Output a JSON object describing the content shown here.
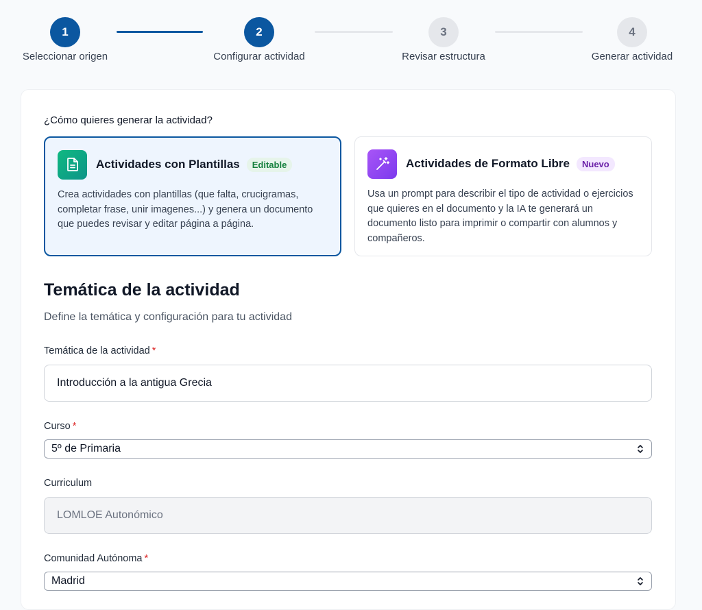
{
  "stepper": {
    "steps": [
      {
        "number": "1",
        "label": "Seleccionar origen"
      },
      {
        "number": "2",
        "label": "Configurar actividad"
      },
      {
        "number": "3",
        "label": "Revisar estructura"
      },
      {
        "number": "4",
        "label": "Generar actividad"
      }
    ],
    "current_step": 2
  },
  "generation": {
    "question": "¿Cómo quieres generar la actividad?",
    "options": [
      {
        "title": "Actividades con Plantillas",
        "badge": "Editable",
        "icon": "document-icon",
        "description": "Crea actividades con plantillas (que falta, crucigramas, completar frase, unir imagenes...) y genera un documento que puedes revisar y editar página a página.",
        "selected": true
      },
      {
        "title": "Actividades de Formato Libre",
        "badge": "Nuevo",
        "icon": "magic-wand-icon",
        "description": "Usa un prompt para describir el tipo de actividad o ejercicios que quieres en el documento y la IA te generará un documento listo para imprimir o compartir con alumnos y compañeros.",
        "selected": false
      }
    ]
  },
  "section": {
    "title": "Temática de la actividad",
    "subtitle": "Define la temática y configuración para tu actividad"
  },
  "form": {
    "topic": {
      "label": "Temática de la actividad",
      "required": "*",
      "value": "Introducción a la antigua Grecia"
    },
    "course": {
      "label": "Curso",
      "required": "*",
      "value": "5º de Primaria"
    },
    "curriculum": {
      "label": "Curriculum",
      "value": "LOMLOE Autonómico"
    },
    "community": {
      "label": "Comunidad Autónoma",
      "required": "*",
      "value": "Madrid"
    }
  },
  "colors": {
    "primary": "#0b57a0",
    "inactive_step": "#e5e7eb",
    "required": "#dc2626",
    "editable_badge": "#15803d",
    "new_badge": "#6b21a8"
  }
}
